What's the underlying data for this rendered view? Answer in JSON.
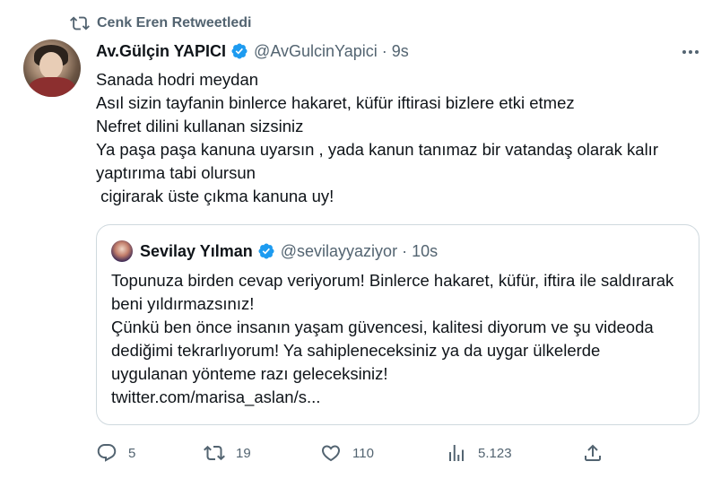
{
  "retweet": {
    "label": "Cenk Eren Retweetledi",
    "icon": "retweet-icon"
  },
  "tweet": {
    "author_name": "Av.Gülçin YAPICI",
    "handle": "@AvGulcinYapici",
    "separator": "·",
    "time": "9s",
    "text": "Sanada hodri meydan\nAsıl sizin tayfanin binlerce hakaret, küfür iftirasi bizlere etki etmez\nNefret dilini kullanan sizsiniz\nYa paşa paşa kanuna uyarsın , yada kanun tanımaz bir vatandaş olarak kalır yaptırıma tabi olursun\n cigirarak üste çıkma kanuna uy!"
  },
  "quote": {
    "author_name": "Sevilay Yılman",
    "handle": "@sevilayyaziyor",
    "separator": "·",
    "time": "10s",
    "text": "Topunuza birden cevap veriyorum! Binlerce hakaret, küfür, iftira ile saldırarak beni yıldırmazsınız!\nÇünkü ben önce insanın yaşam güvencesi, kalitesi diyorum ve şu videoda dediğimi tekrarlıyorum! Ya sahipleneceksiniz ya da uygar ülkelerde uygulanan yönteme razı geleceksiniz!\ntwitter.com/marisa_aslan/s..."
  },
  "actions": {
    "replies": "5",
    "retweets": "19",
    "likes": "110",
    "views": "5.123"
  },
  "colors": {
    "verified": "#1d9bf0",
    "muted": "#536471",
    "text": "#0f1419",
    "border": "#cfd9de"
  }
}
